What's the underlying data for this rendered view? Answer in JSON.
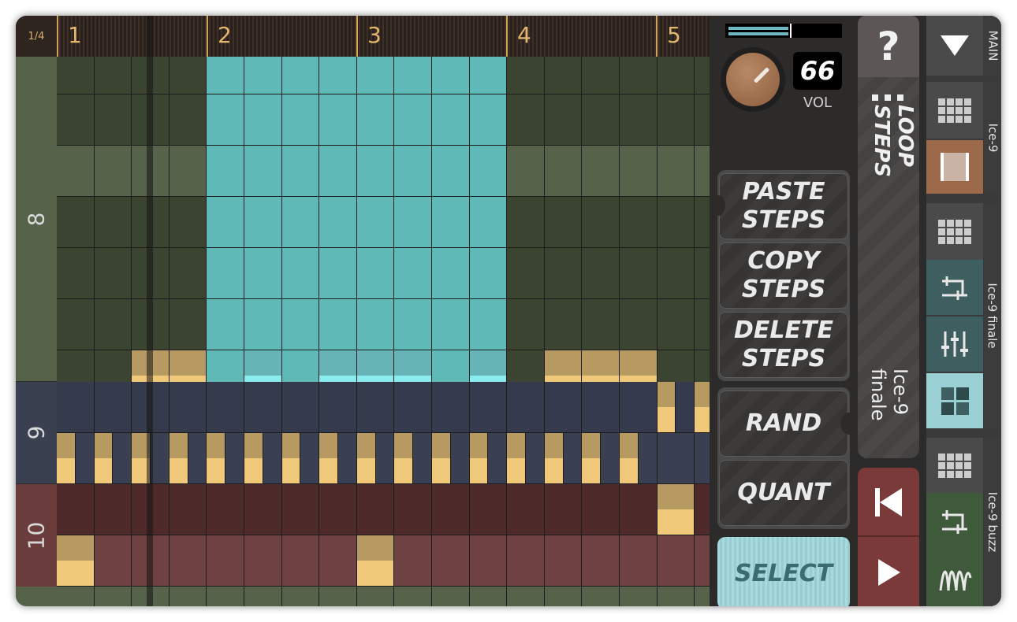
{
  "ruler": {
    "zoom": "1/4",
    "bars": [
      "1",
      "2",
      "3",
      "4",
      "5"
    ]
  },
  "tracks": [
    {
      "label": "8"
    },
    {
      "label": "9"
    },
    {
      "label": "10"
    }
  ],
  "volume": {
    "value": "66",
    "label": "VOL",
    "level": 0.66
  },
  "buttons": {
    "paste": "PASTE\nSTEPS",
    "copy": "COPY\nSTEPS",
    "delete": "DELETE\nSTEPS",
    "rand": "RAND",
    "quant": "QUANT",
    "select": "SELECT"
  },
  "side": {
    "help": "?",
    "loop_steps": "LOOP\nSTEPS",
    "pattern_name": "Ice-9\nfinale"
  },
  "instruments": {
    "main": "MAIN",
    "ice9": "Ice-9",
    "ice9_finale": "Ice-9 finale",
    "ice9_buzz": "Ice-9 buzz"
  },
  "icons": {
    "dropdown": "triangle-down-icon",
    "grid": "grid-icon",
    "loop": "loop-region-icon",
    "routing": "routing-icon",
    "mixer": "mixer-sliders-icon",
    "pads": "pads-icon",
    "wave": "waveform-icon",
    "rewind": "skip-back-icon",
    "play": "play-icon"
  },
  "colors": {
    "accent_teal": "#5fbab7",
    "accent_gold": "#f0c87a",
    "track8_dark": "#3a4431",
    "track8_light": "#56624a",
    "track9": "#353b4c",
    "track10": "#4e2a2a",
    "transport": "#7a3a3a"
  }
}
